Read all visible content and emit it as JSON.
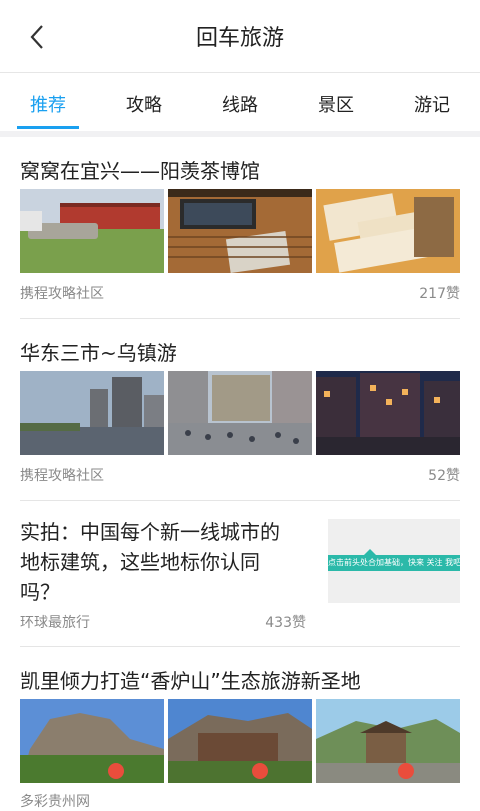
{
  "header": {
    "title": "回车旅游"
  },
  "tabs": [
    {
      "label": "推荐"
    },
    {
      "label": "攻略"
    },
    {
      "label": "线路"
    },
    {
      "label": "景区"
    },
    {
      "label": "游记"
    }
  ],
  "articles": [
    {
      "title": "窝窝在宜兴——阳羡茶博馆",
      "source": "携程攻略社区",
      "likes": "217赞"
    },
    {
      "title": "华东三市~乌镇游",
      "source": "携程攻略社区",
      "likes": "52赞"
    },
    {
      "title_line1": "实拍：中国每个新一线城市的",
      "title_line2": "地标建筑，这些地标你认同",
      "title_line3": "吗？",
      "source": "环球最旅行",
      "likes": "433赞",
      "thumb_text": "点击前头处合加基础，快来 关注 我吧!"
    },
    {
      "title": "凯里倾力打造“香炉山”生态旅游新圣地",
      "source": "多彩贵州网"
    }
  ],
  "colors": {
    "accent": "#1aa0f0"
  }
}
